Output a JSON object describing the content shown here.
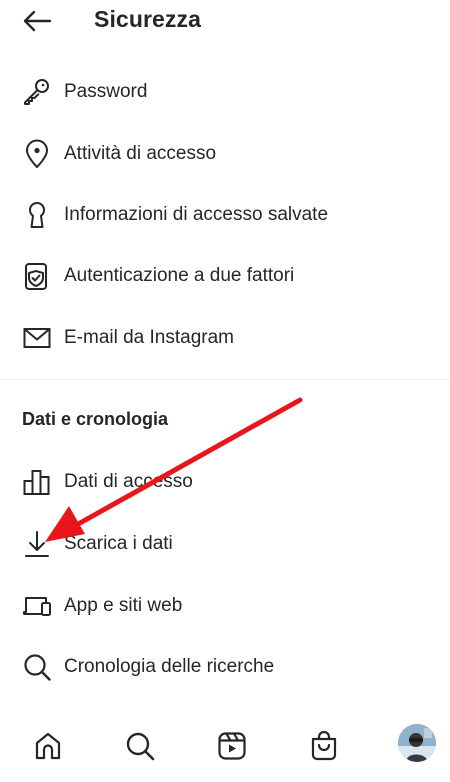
{
  "header": {
    "title": "Sicurezza",
    "back_icon": "arrow-left-icon"
  },
  "security_items": [
    {
      "label": "Password",
      "icon": "key-icon"
    },
    {
      "label": "Attività di accesso",
      "icon": "location-pin-icon"
    },
    {
      "label": "Informazioni di accesso salvate",
      "icon": "keyhole-icon"
    },
    {
      "label": "Autenticazione a due fattori",
      "icon": "shield-phone-icon"
    },
    {
      "label": "E-mail da Instagram",
      "icon": "envelope-icon"
    }
  ],
  "data_section": {
    "title": "Dati e cronologia",
    "items": [
      {
        "label": "Dati di accesso",
        "icon": "bar-chart-icon"
      },
      {
        "label": "Scarica i dati",
        "icon": "download-icon"
      },
      {
        "label": "App e siti web",
        "icon": "devices-icon"
      },
      {
        "label": "Cronologia delle ricerche",
        "icon": "search-icon"
      }
    ]
  },
  "bottom_nav": {
    "items": [
      "home-icon",
      "search-icon",
      "reels-icon",
      "shop-icon",
      "profile-avatar"
    ]
  },
  "annotation": {
    "arrow_color": "#e8161b"
  }
}
